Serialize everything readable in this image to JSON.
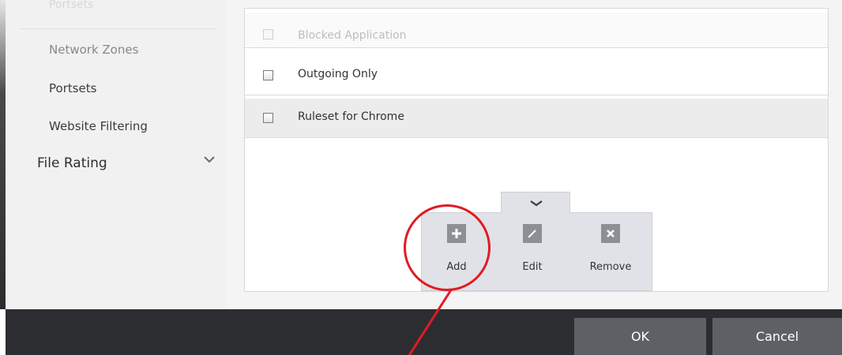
{
  "sidebar": {
    "top_partial": "Portsets",
    "items": [
      {
        "label": "Network Zones"
      },
      {
        "label": "Portsets"
      },
      {
        "label": "Website Filtering"
      }
    ],
    "group": {
      "label": "File Rating",
      "chevron_icon": "chevron-down-icon"
    }
  },
  "rulesets": [
    {
      "label": "Blocked Application",
      "checked": false,
      "state": "faded"
    },
    {
      "label": "Outgoing Only",
      "checked": false,
      "state": "normal"
    },
    {
      "label": "Ruleset for Chrome",
      "checked": false,
      "state": "selected"
    }
  ],
  "toolbar": {
    "toggle_icon": "chevron-down-icon",
    "add_label": "Add",
    "add_icon": "plus-icon",
    "edit_label": "Edit",
    "edit_icon": "pencil-icon",
    "remove_label": "Remove",
    "remove_icon": "close-icon"
  },
  "annotation": {
    "color": "#e01b24"
  },
  "footer": {
    "ok_label": "OK",
    "cancel_label": "Cancel"
  }
}
